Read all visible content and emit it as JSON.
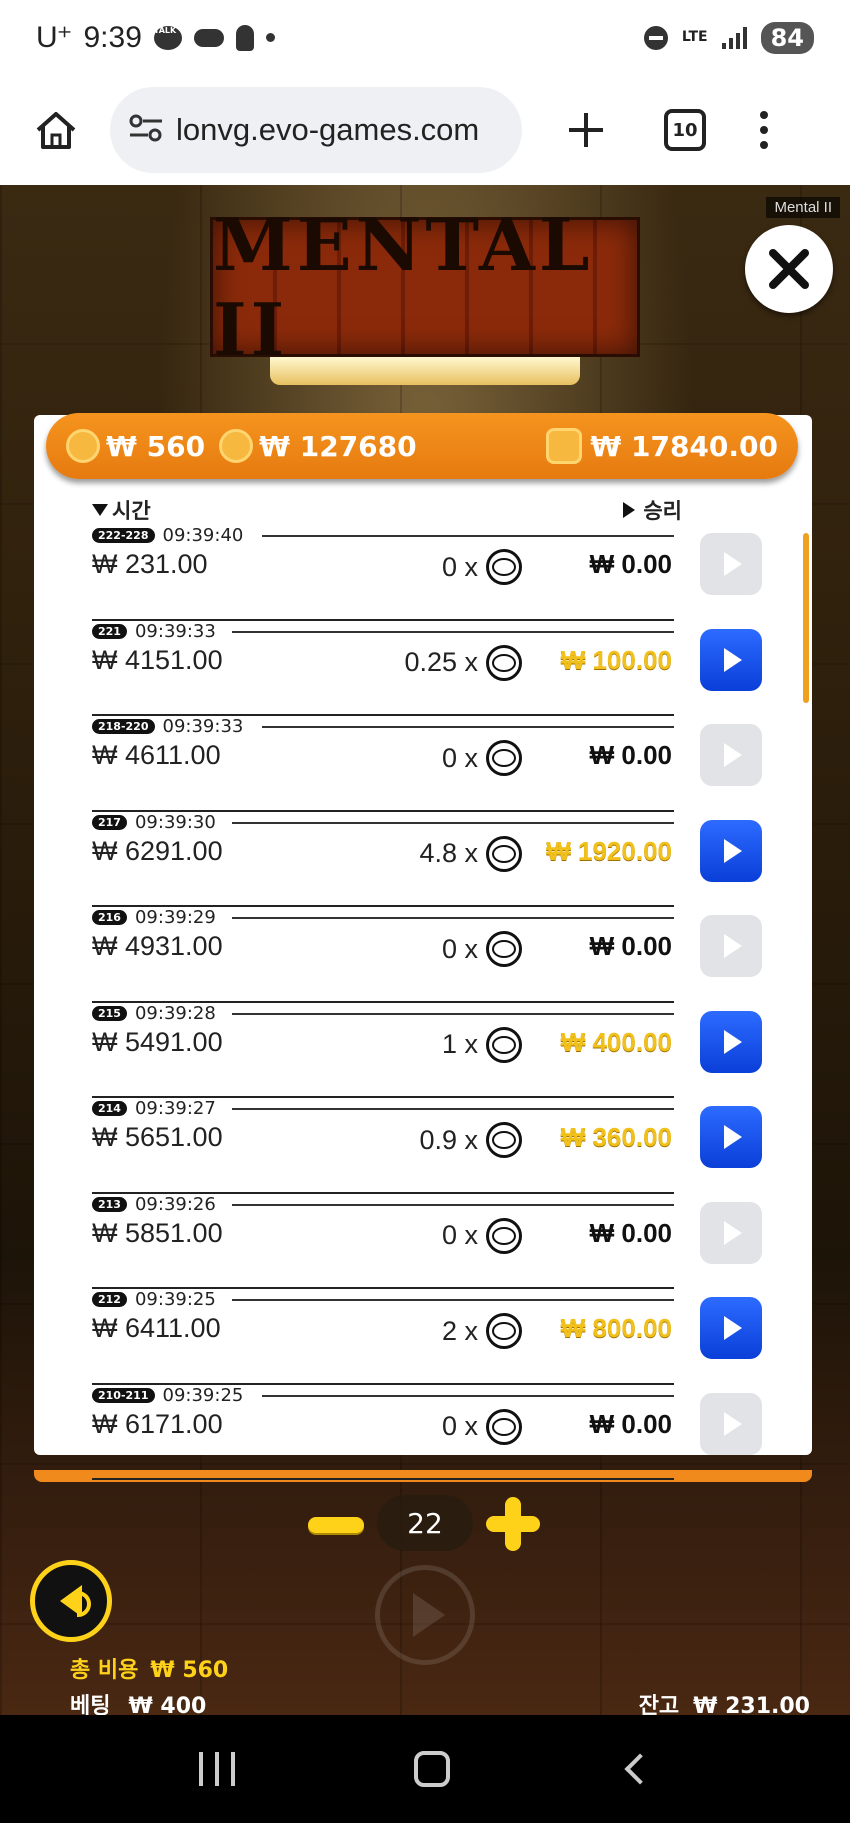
{
  "status_bar": {
    "carrier": "U⁺",
    "time": "9:39",
    "talk_icon_text": "TALK",
    "network": "LTE",
    "battery": "84"
  },
  "browser": {
    "url": "lonvg.evo-games.com",
    "tab_count": "10"
  },
  "game": {
    "tag": "Mental II",
    "logo_text": "MENTAL II",
    "topbar": {
      "cost": "₩ 560",
      "total": "₩ 127680",
      "wallet": "₩ 17840.00"
    },
    "headers": {
      "time": "시간",
      "win": "승리"
    },
    "rows": [
      {
        "round": "222-228",
        "time": "09:39:40",
        "bet": "₩ 231.00",
        "mult": "0 x",
        "payout": "₩ 0.00",
        "win": false
      },
      {
        "round": "221",
        "time": "09:39:33",
        "bet": "₩ 4151.00",
        "mult": "0.25 x",
        "payout": "₩ 100.00",
        "win": true
      },
      {
        "round": "218-220",
        "time": "09:39:33",
        "bet": "₩ 4611.00",
        "mult": "0 x",
        "payout": "₩ 0.00",
        "win": false
      },
      {
        "round": "217",
        "time": "09:39:30",
        "bet": "₩ 6291.00",
        "mult": "4.8 x",
        "payout": "₩ 1920.00",
        "win": true
      },
      {
        "round": "216",
        "time": "09:39:29",
        "bet": "₩ 4931.00",
        "mult": "0 x",
        "payout": "₩ 0.00",
        "win": false
      },
      {
        "round": "215",
        "time": "09:39:28",
        "bet": "₩ 5491.00",
        "mult": "1 x",
        "payout": "₩ 400.00",
        "win": true
      },
      {
        "round": "214",
        "time": "09:39:27",
        "bet": "₩ 5651.00",
        "mult": "0.9 x",
        "payout": "₩ 360.00",
        "win": true
      },
      {
        "round": "213",
        "time": "09:39:26",
        "bet": "₩ 5851.00",
        "mult": "0 x",
        "payout": "₩ 0.00",
        "win": false
      },
      {
        "round": "212",
        "time": "09:39:25",
        "bet": "₩ 6411.00",
        "mult": "2 x",
        "payout": "₩ 800.00",
        "win": true
      },
      {
        "round": "210-211",
        "time": "09:39:25",
        "bet": "₩ 6171.00",
        "mult": "0 x",
        "payout": "₩ 0.00",
        "win": false
      }
    ],
    "counter": "22",
    "total_cost_label": "총 비용",
    "total_cost_value": "₩ 560",
    "bet_label": "베팅",
    "bet_value": "₩ 400",
    "balance_label": "잔고",
    "balance_value": "₩ 231.00"
  }
}
